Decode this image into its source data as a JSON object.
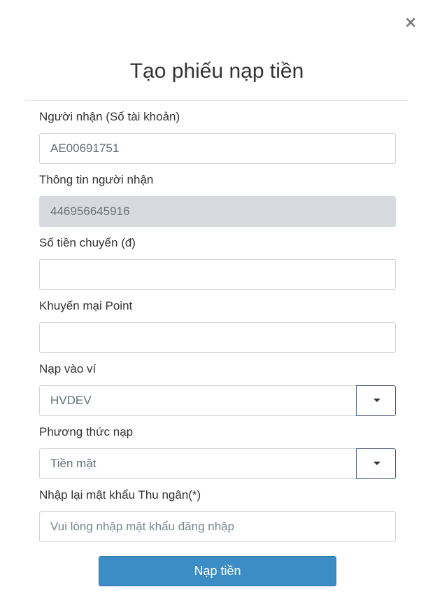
{
  "dialog": {
    "title": "Tạo phiếu nạp tiền",
    "close_label": "×"
  },
  "form": {
    "recipient_account": {
      "label": "Người nhận (Số tài khoản)",
      "value": "AE00691751"
    },
    "recipient_info": {
      "label": "Thông tin người nhận",
      "value": "446956645916"
    },
    "amount": {
      "label": "Số tiền chuyển (đ)",
      "value": ""
    },
    "promo_point": {
      "label": "Khuyến mại Point",
      "value": ""
    },
    "wallet": {
      "label": "Nạp vào ví",
      "selected": "HVDEV"
    },
    "method": {
      "label": "Phương thức nạp",
      "selected": "Tiền mặt"
    },
    "cashier_password": {
      "label": "Nhập lại mật khẩu Thu ngân(*)",
      "placeholder": "Vui lòng nhập mật khẩu đăng nhập"
    }
  },
  "actions": {
    "submit_label": "Nạp tiền"
  },
  "colors": {
    "primary_button": "#3c8dc5",
    "readonly_background": "#d7dadf",
    "border": "#cfd4da"
  }
}
